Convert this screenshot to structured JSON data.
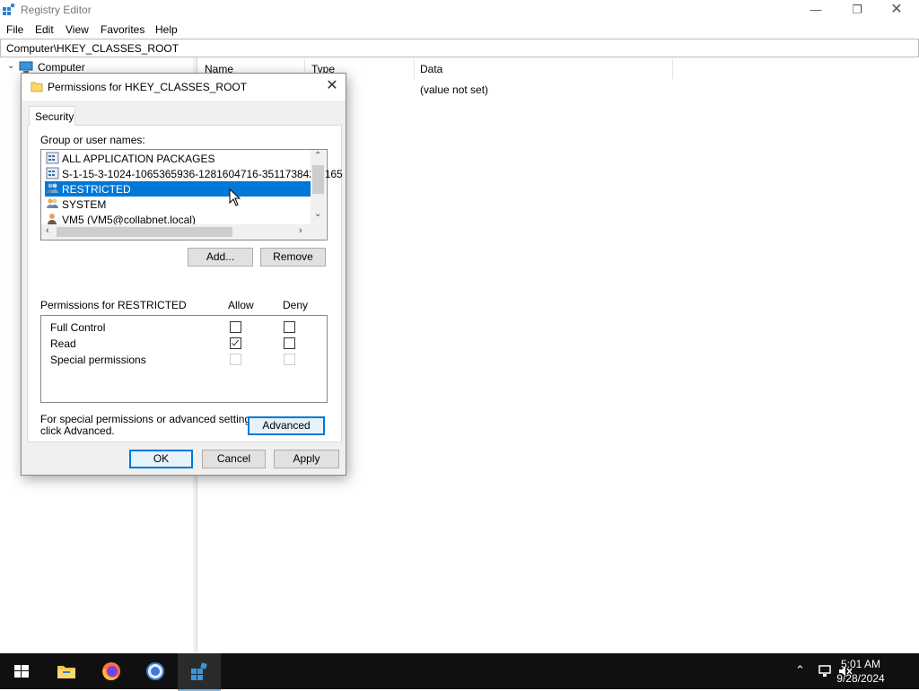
{
  "window": {
    "title": "Registry Editor"
  },
  "menu": [
    "File",
    "Edit",
    "View",
    "Favorites",
    "Help"
  ],
  "address": "Computer\\HKEY_CLASSES_ROOT",
  "tree": {
    "root": "Computer"
  },
  "list": {
    "columns": [
      "Name",
      "Type",
      "Data"
    ],
    "rows": [
      {
        "data": "(value not set)"
      }
    ]
  },
  "dialog": {
    "title": "Permissions for HKEY_CLASSES_ROOT",
    "tab": "Security",
    "group_label": "Group or user names:",
    "groups": [
      "ALL APPLICATION PACKAGES",
      "S-1-15-3-1024-1065365936-1281604716-3511738428-165",
      "RESTRICTED",
      "SYSTEM",
      "VM5 (VM5@collabnet.local)"
    ],
    "selected_group": 2,
    "add_label": "Add...",
    "remove_label": "Remove",
    "perm_header": "Permissions for RESTRICTED",
    "allow_label": "Allow",
    "deny_label": "Deny",
    "permissions": [
      {
        "name": "Full Control",
        "allow": false,
        "deny": false,
        "disabled": false
      },
      {
        "name": "Read",
        "allow": true,
        "deny": false,
        "disabled": false
      },
      {
        "name": "Special permissions",
        "allow": false,
        "deny": false,
        "disabled": true
      }
    ],
    "advanced_text_1": "For special permissions or advanced settings,",
    "advanced_text_2": "click Advanced.",
    "advanced_label": "Advanced",
    "ok_label": "OK",
    "cancel_label": "Cancel",
    "apply_label": "Apply"
  },
  "taskbar": {
    "time": "5:01 AM",
    "date": "9/28/2024"
  },
  "colors": {
    "accent": "#0078d7",
    "taskbar": "#101010"
  }
}
